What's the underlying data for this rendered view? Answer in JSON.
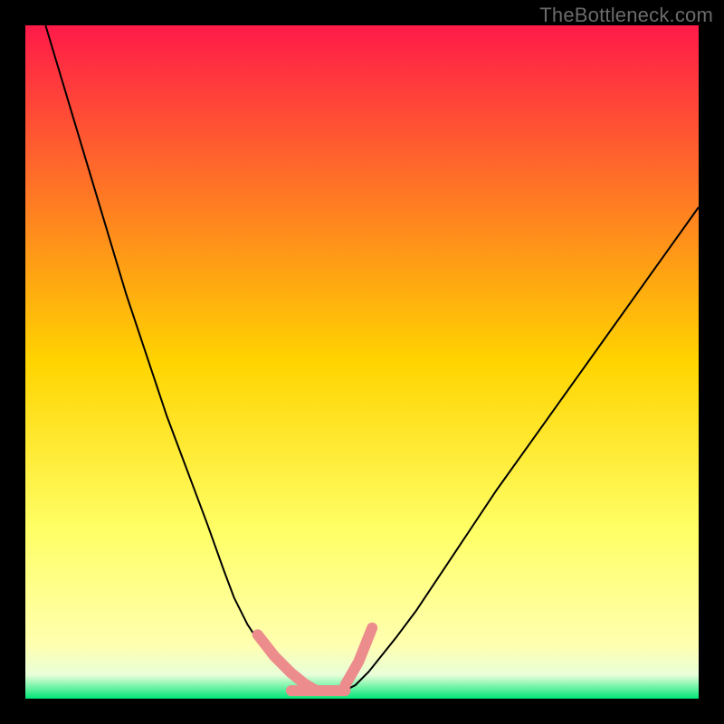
{
  "watermark": {
    "text": "TheBottleneck.com"
  },
  "chart_data": {
    "type": "line",
    "title": "",
    "xlabel": "",
    "ylabel": "",
    "xlim": [
      0,
      100
    ],
    "ylim": [
      0,
      100
    ],
    "grid": false,
    "legend": false,
    "background_gradient": {
      "stops": [
        {
          "offset": 0.0,
          "color": "#ff1a49"
        },
        {
          "offset": 0.5,
          "color": "#ffd400"
        },
        {
          "offset": 0.75,
          "color": "#ffff66"
        },
        {
          "offset": 0.92,
          "color": "#ffffb0"
        },
        {
          "offset": 0.965,
          "color": "#e8ffd9"
        },
        {
          "offset": 1.0,
          "color": "#00e676"
        }
      ]
    },
    "series": [
      {
        "name": "left-curve",
        "color": "#000000",
        "width": 2,
        "x": [
          3,
          6,
          9,
          12,
          15,
          18,
          21,
          24,
          27,
          29.5,
          31,
          33,
          35,
          37,
          39,
          41,
          43
        ],
        "values": [
          100,
          90,
          80,
          70,
          60,
          51,
          42,
          34,
          26,
          19,
          15,
          11,
          8,
          5.5,
          3.5,
          2,
          1
        ]
      },
      {
        "name": "right-curve",
        "color": "#000000",
        "width": 2,
        "x": [
          47,
          49,
          51,
          53,
          55,
          58,
          62,
          66,
          70,
          75,
          80,
          85,
          90,
          95,
          100
        ],
        "values": [
          1,
          2,
          4,
          6.5,
          9,
          13,
          19,
          25,
          31,
          38,
          45,
          52,
          59,
          66,
          73
        ]
      },
      {
        "name": "highlight-left",
        "color": "#ed8c8c",
        "width": 12,
        "linecap": "round",
        "x": [
          34.5,
          37,
          39.5,
          41.5,
          43
        ],
        "values": [
          9.5,
          6.3,
          3.8,
          2.2,
          1.3
        ]
      },
      {
        "name": "highlight-bottom",
        "color": "#ed8c8c",
        "width": 12,
        "linecap": "round",
        "x": [
          39.5,
          47.5
        ],
        "values": [
          1.2,
          1.2
        ]
      },
      {
        "name": "highlight-right",
        "color": "#ed8c8c",
        "width": 12,
        "linecap": "round",
        "x": [
          47.5,
          49.5,
          51.5
        ],
        "values": [
          2.0,
          5.5,
          10.5
        ]
      }
    ]
  }
}
